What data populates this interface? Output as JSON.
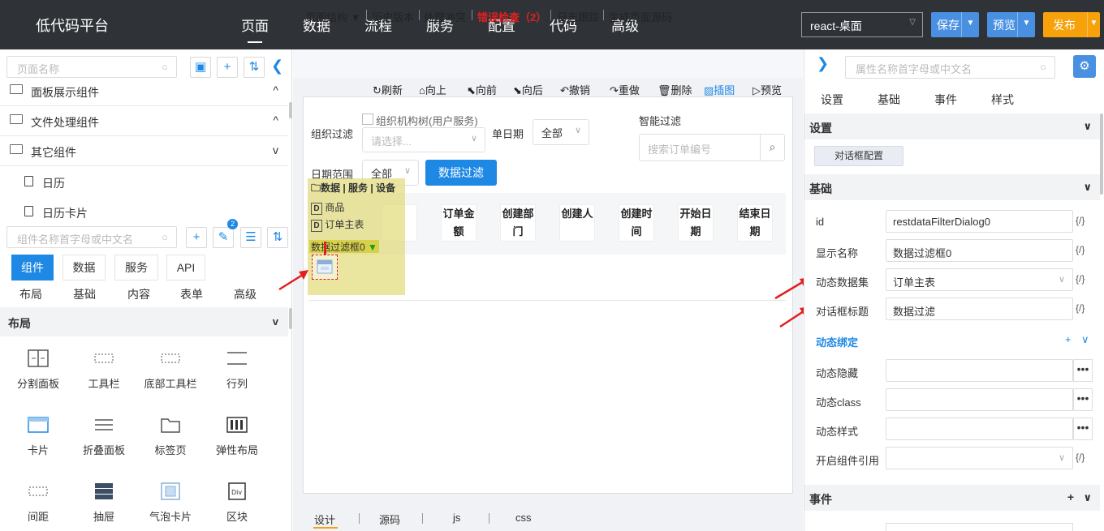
{
  "brand": "低代码平台",
  "nav": [
    "页面",
    "数据",
    "流程",
    "服务",
    "配置",
    "代码",
    "高级"
  ],
  "top_controls": {
    "env": "react-桌面",
    "save": "保存",
    "preview": "预览",
    "publish": "发布"
  },
  "colors": {
    "topbar": "#2f3338",
    "primary": "#1e88e5",
    "publish": "#f7a20b",
    "error": "#e02020",
    "selection": "#e1dc78"
  },
  "left": {
    "page_search_placeholder": "页面名称",
    "groups": [
      {
        "label": "面板展示组件",
        "arrow": "^"
      },
      {
        "label": "文件处理组件",
        "arrow": "^"
      },
      {
        "label": "其它组件",
        "arrow": "v"
      }
    ],
    "leaves": [
      "日历",
      "日历卡片"
    ],
    "comp_search_placeholder": "组件名称首字母或中文名",
    "badge": "2",
    "tabs": [
      "组件",
      "数据",
      "服务",
      "API"
    ],
    "subtabs": [
      "布局",
      "基础",
      "内容",
      "表单",
      "高级"
    ],
    "section": "布局",
    "components": [
      "分割面板",
      "工具栏",
      "底部工具栏",
      "行列",
      "卡片",
      "折叠面板",
      "标签页",
      "弹性布局",
      "间距",
      "抽屉",
      "气泡卡片",
      "区块"
    ]
  },
  "middle": {
    "toolbar": [
      "页面结构 ▼",
      "历史版本",
      "处理冲突",
      "错误检查（2）",
      "日志跟踪",
      "生成页面源码"
    ],
    "actions": [
      "刷新",
      "向上",
      "向前",
      "向后",
      "撤销",
      "重做",
      "删除",
      "插图",
      "预览"
    ],
    "filter": {
      "org_label": "组织过滤",
      "org_checkbox": "组织机构树(用户服务)",
      "org_placeholder": "请选择...",
      "single_date": "单日期",
      "all": "全部",
      "smart": "智能过滤",
      "search_placeholder": "搜索订单编号",
      "date_range": "日期范围",
      "filter_btn": "数据过滤"
    },
    "table_headers": [
      "订单金额",
      "创建部门",
      "创建人",
      "创建时间",
      "开始日期",
      "结束日期"
    ],
    "tree": {
      "path": "数据 | 服务 | 设备",
      "items": [
        "商品",
        "订单主表"
      ],
      "selected": "数据过滤框0"
    },
    "bottom_tabs": [
      "设计",
      "源码",
      "js",
      "css"
    ]
  },
  "right": {
    "search_placeholder": "属性名称首字母或中文名",
    "tabs": [
      "设置",
      "基础",
      "事件",
      "样式"
    ],
    "sec_settings": "设置",
    "dialog_btn": "对话框配置",
    "sec_basic": "基础",
    "props": [
      {
        "label": "id",
        "value": "restdataFilterDialog0"
      },
      {
        "label": "显示名称",
        "value": "数据过滤框0"
      },
      {
        "label": "动态数据集",
        "value": "订单主表"
      },
      {
        "label": "对话框标题",
        "value": "数据过滤"
      }
    ],
    "dynamic_binding": "动态绑定",
    "dyn_props": [
      "动态隐藏",
      "动态class",
      "动态样式"
    ],
    "ref_label": "开启组件引用",
    "sec_events": "事件",
    "curly": "{/}"
  }
}
